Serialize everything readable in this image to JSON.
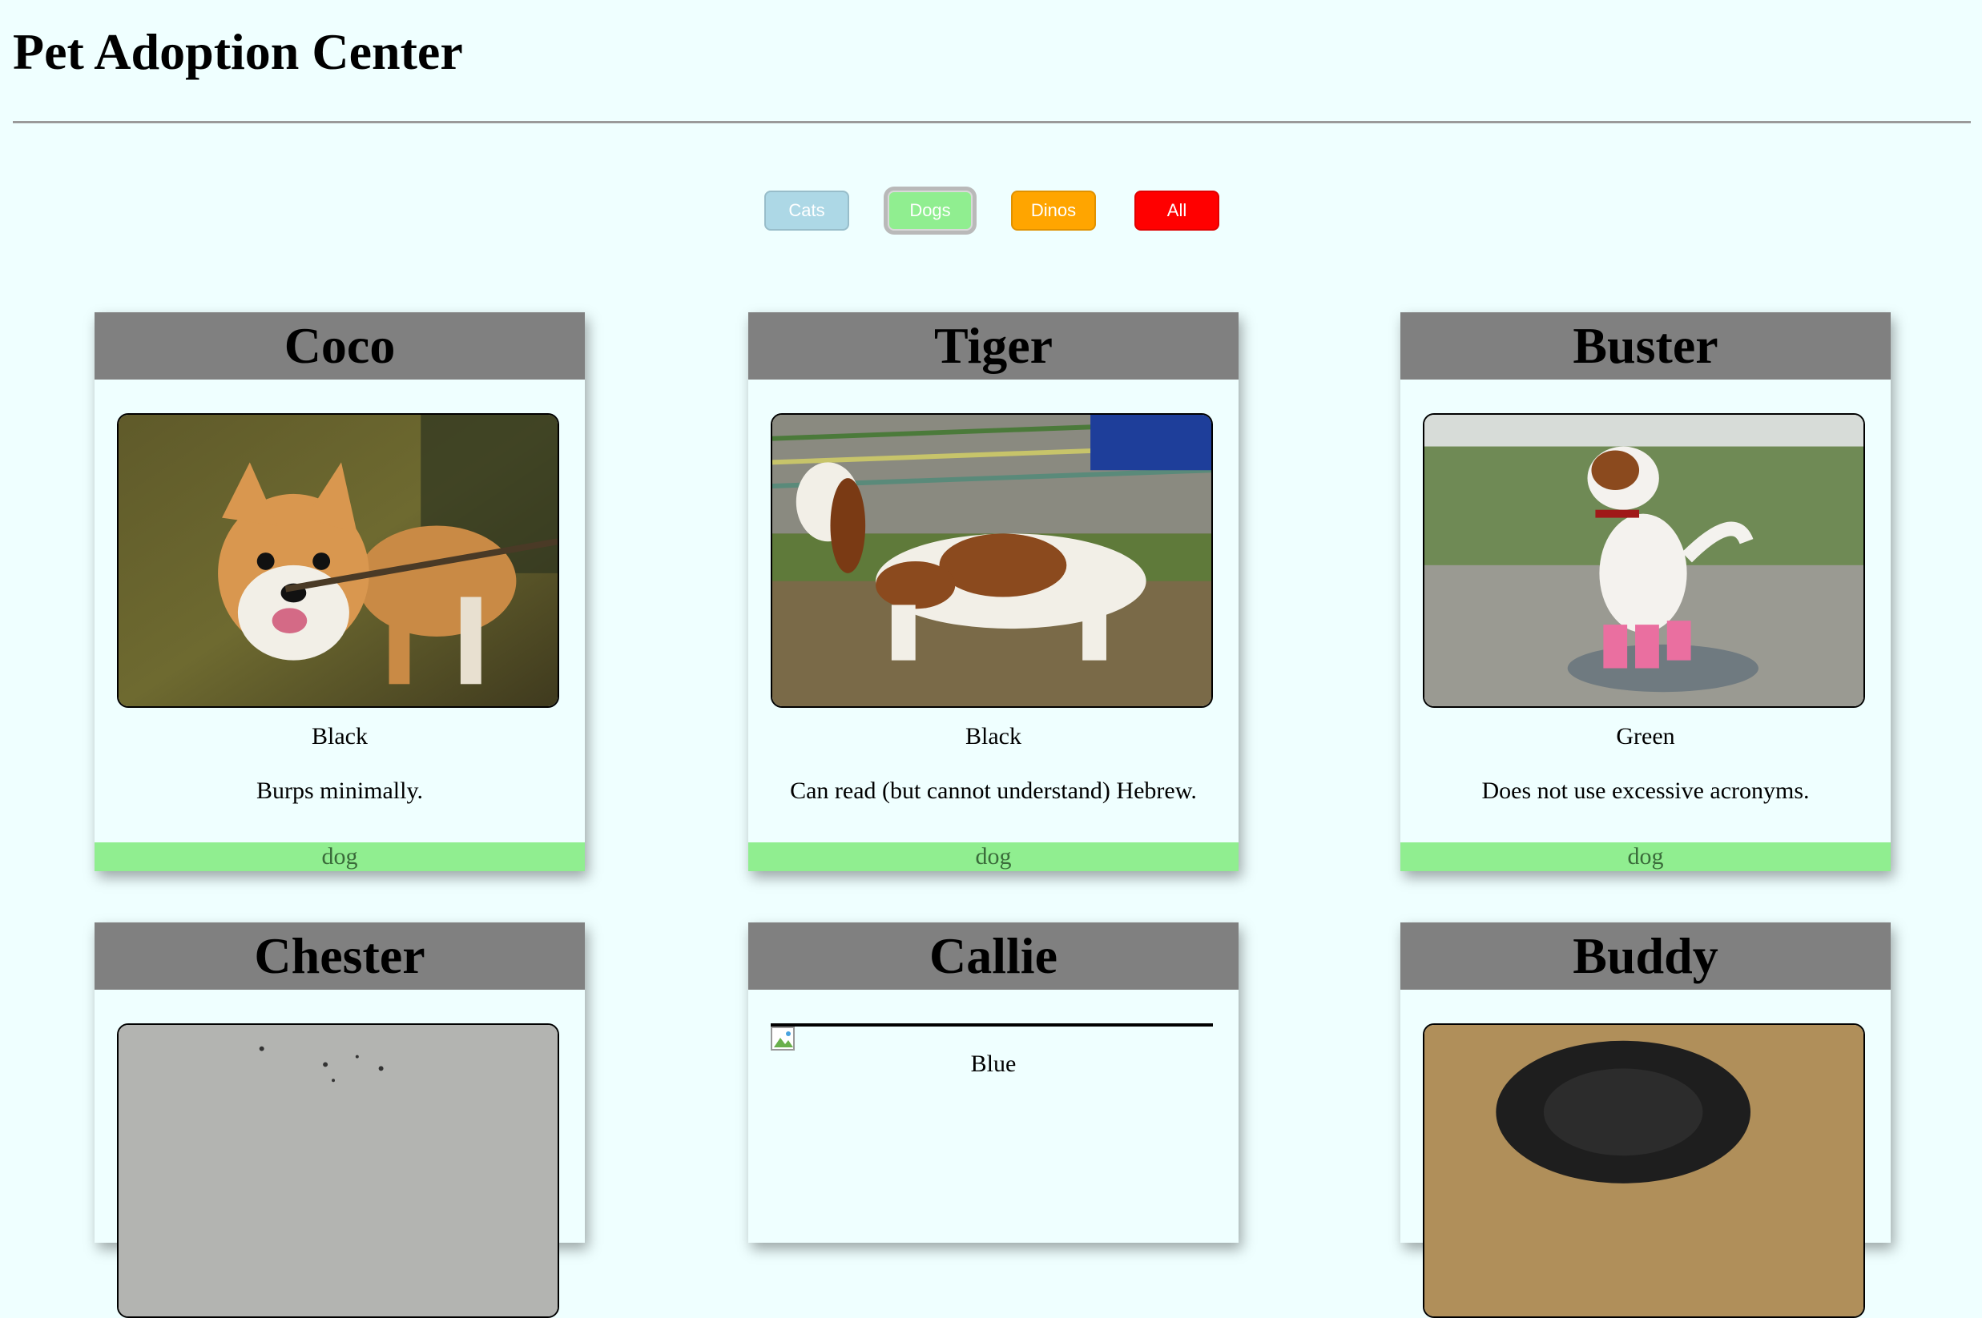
{
  "header": {
    "title": "Pet Adoption Center"
  },
  "filters": [
    {
      "label": "Cats",
      "color": "#add8e6"
    },
    {
      "label": "Dogs",
      "color": "#90ee90",
      "active": true
    },
    {
      "label": "Dinos",
      "color": "#ffa500"
    },
    {
      "label": "All",
      "color": "#ff0000"
    }
  ],
  "pets": [
    {
      "name": "Coco",
      "color": "Black",
      "description": "Burps minimally.",
      "type": "dog",
      "photo": "corgi-photo"
    },
    {
      "name": "Tiger",
      "color": "Black",
      "description": "Can read (but cannot understand) Hebrew.",
      "type": "dog",
      "photo": "basset-hound-photo"
    },
    {
      "name": "Buster",
      "color": "Green",
      "description": "Does not use excessive acronyms.",
      "type": "dog",
      "photo": "jack-russell-photo"
    },
    {
      "name": "Chester",
      "photo": "concrete-wall-photo"
    },
    {
      "name": "Callie",
      "color": "Blue",
      "photo": "broken-image-icon"
    },
    {
      "name": "Buddy",
      "photo": "black-dog-photo"
    }
  ],
  "colors": {
    "page_background": "#efffff",
    "card_header": "#808080",
    "type_footer": "#90ee90"
  }
}
